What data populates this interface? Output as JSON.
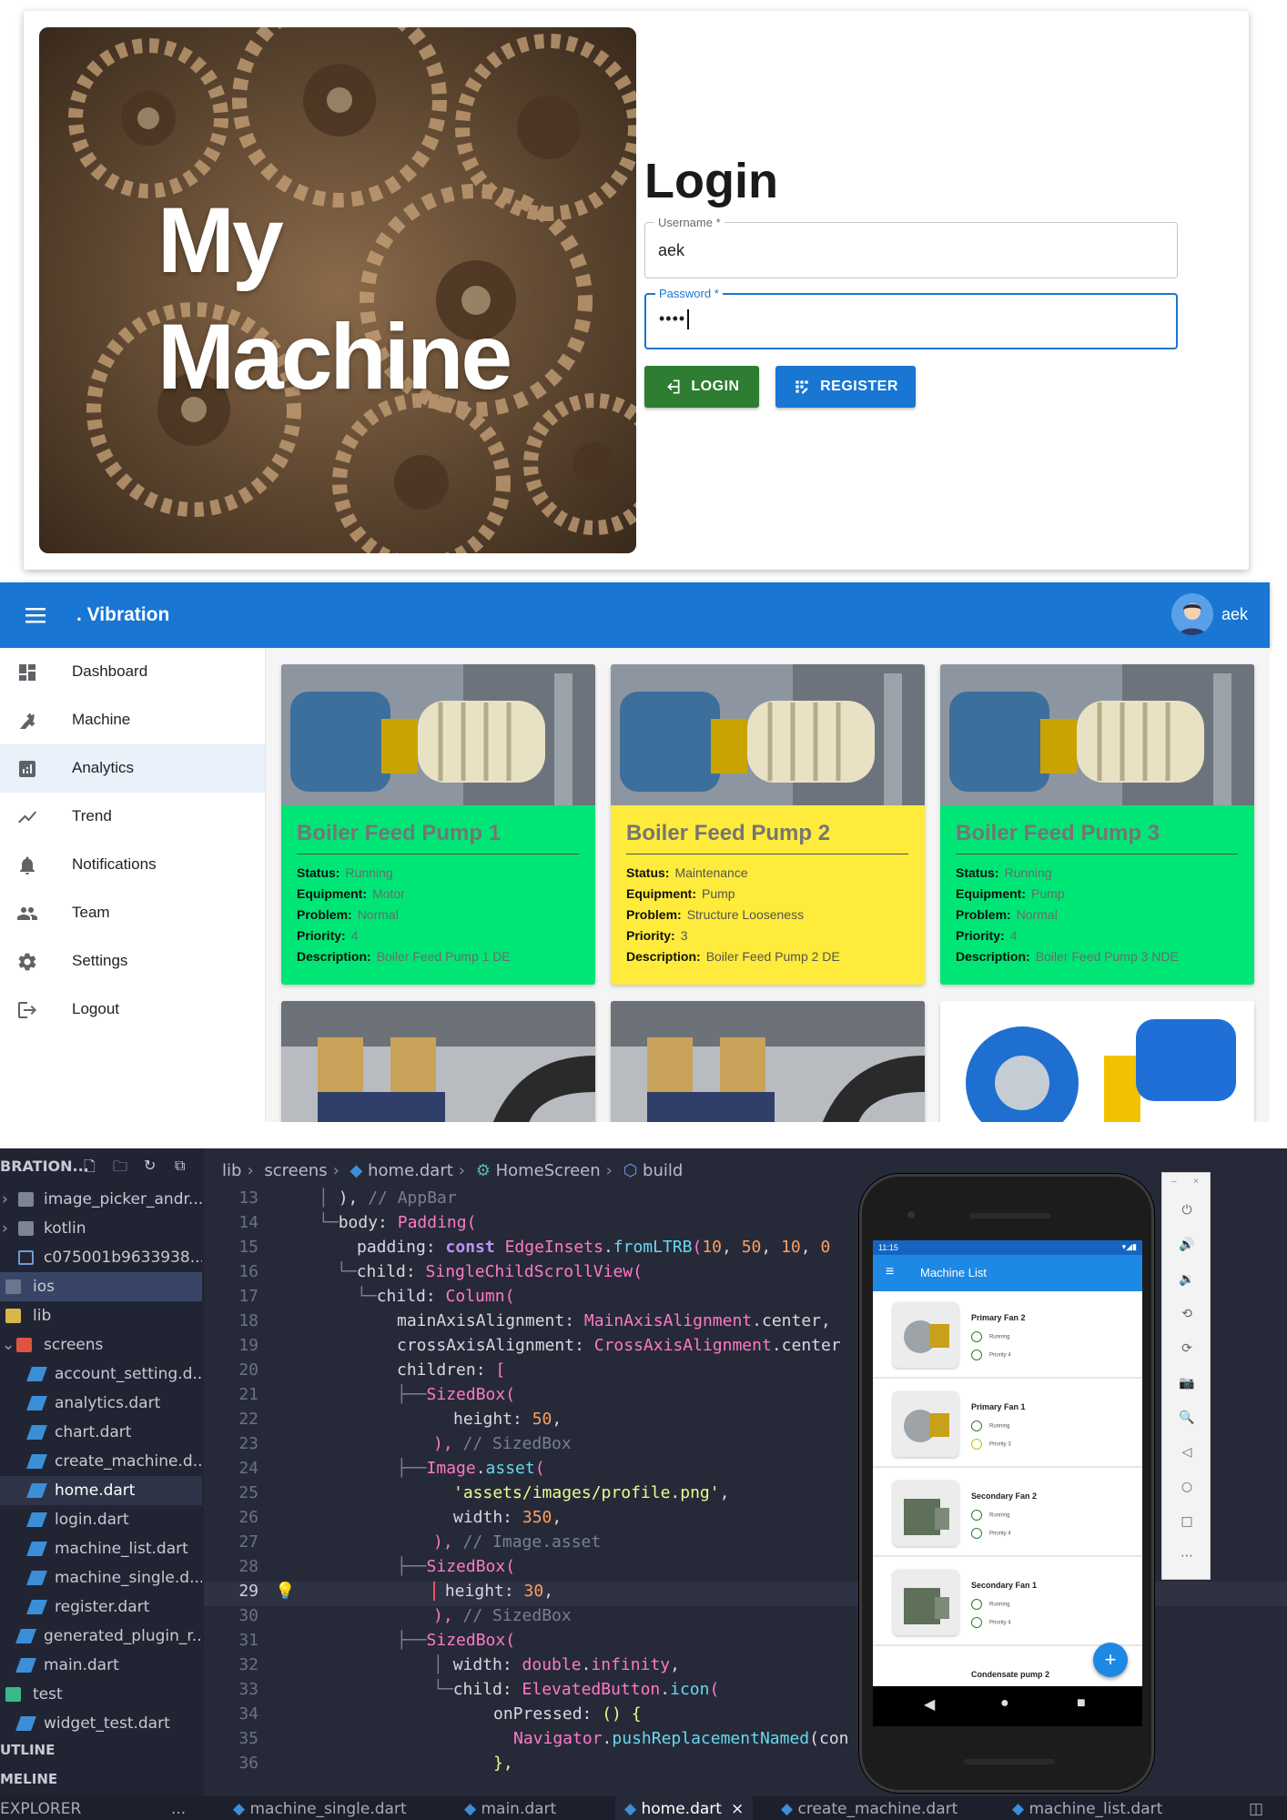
{
  "login": {
    "hero_line1": "My",
    "hero_line2": "Machine",
    "title": "Login",
    "username_label": "Username *",
    "username_value": "aek",
    "password_label": "Password *",
    "password_value": "••••",
    "login_button": "LOGIN",
    "register_button": "REGISTER",
    "accent_green": "#2e7d32",
    "accent_blue": "#1976d2"
  },
  "dashboard": {
    "app_title": ". Vibration",
    "user_name": "aek",
    "nav": [
      {
        "label": "Dashboard",
        "icon": "dashboard-icon"
      },
      {
        "label": "Machine",
        "icon": "precision-icon"
      },
      {
        "label": "Analytics",
        "icon": "analytics-icon",
        "active": true
      },
      {
        "label": "Trend",
        "icon": "trend-icon"
      },
      {
        "label": "Notifications",
        "icon": "bell-icon"
      },
      {
        "label": "Team",
        "icon": "team-icon"
      },
      {
        "label": "Settings",
        "icon": "gear-icon"
      },
      {
        "label": "Logout",
        "icon": "logout-icon"
      }
    ],
    "cards": [
      {
        "title": "Boiler Feed Pump 1",
        "status": "Running",
        "equipment": "Motor",
        "problem": "Normal",
        "priority": "4",
        "description": "Boiler Feed Pump 1 DE",
        "color": "#00e676"
      },
      {
        "title": "Boiler Feed Pump 2",
        "status": "Maintenance",
        "equipment": "Pump",
        "problem": "Structure Looseness",
        "priority": "3",
        "description": "Boiler Feed Pump 2 DE",
        "color": "#ffeb3b"
      },
      {
        "title": "Boiler Feed Pump 3",
        "status": "Running",
        "equipment": "Pump",
        "problem": "Normal",
        "priority": "4",
        "description": "Boiler Feed Pump 3 NDE",
        "color": "#00e676"
      }
    ],
    "labels": {
      "status": "Status:",
      "equipment": "Equipment:",
      "problem": "Problem:",
      "priority": "Priority:",
      "description": "Description:"
    }
  },
  "ide": {
    "explorer_title": "BRATION...",
    "tree": [
      {
        "label": "image_picker_andr...",
        "icon": "folder-icon"
      },
      {
        "label": "kotlin",
        "icon": "folder-icon"
      },
      {
        "label": "c075001b9633938...",
        "icon": "file-icon"
      },
      {
        "label": "ios",
        "icon": "ios-folder-icon"
      },
      {
        "label": "lib",
        "icon": "folder-icon"
      },
      {
        "label": "screens",
        "icon": "folder-open-icon"
      },
      {
        "label": "account_setting.d...",
        "icon": "dart-icon"
      },
      {
        "label": "analytics.dart",
        "icon": "dart-icon"
      },
      {
        "label": "chart.dart",
        "icon": "dart-icon"
      },
      {
        "label": "create_machine.d...",
        "icon": "dart-icon"
      },
      {
        "label": "home.dart",
        "icon": "dart-icon"
      },
      {
        "label": "login.dart",
        "icon": "dart-icon"
      },
      {
        "label": "machine_list.dart",
        "icon": "dart-icon"
      },
      {
        "label": "machine_single.d...",
        "icon": "dart-icon"
      },
      {
        "label": "register.dart",
        "icon": "dart-icon"
      },
      {
        "label": "generated_plugin_r...",
        "icon": "dart-icon"
      },
      {
        "label": "main.dart",
        "icon": "dart-icon"
      },
      {
        "label": "test",
        "icon": "test-folder-icon"
      },
      {
        "label": "widget_test.dart",
        "icon": "dart-icon"
      }
    ],
    "outline": "UTLINE",
    "timeline": "MELINE",
    "breadcrumb": [
      "lib",
      "screens",
      "home.dart",
      "HomeScreen",
      "build"
    ],
    "line_numbers": [
      "13",
      "14",
      "15",
      "16",
      "17",
      "18",
      "19",
      "20",
      "21",
      "22",
      "23",
      "24",
      "25",
      "26",
      "27",
      "28",
      "29",
      "30",
      "31",
      "32",
      "33",
      "34",
      "35",
      "36"
    ],
    "code": {
      "l13a": "), ",
      "l13b": "// AppBar",
      "l14a": "body",
      "l14b": ": ",
      "l14c": "Padding",
      "l14d": "(",
      "l15a": "padding: ",
      "l15b": "const ",
      "l15c": "EdgeInsets",
      "l15d": ".",
      "l15e": "fromLTRB",
      "l15f": "(",
      "l15g": "10",
      "l15h": ", ",
      "l15i": "50",
      "l15j": ", ",
      "l15k": "10",
      "l15l": ", ",
      "l15m": "0",
      "l16a": "child: ",
      "l16b": "SingleChildScrollView",
      "l16c": "(",
      "l17a": "child: ",
      "l17b": "Column",
      "l17c": "(",
      "l18a": "mainAxisAlignment: ",
      "l18b": "MainAxisAlignment",
      "l18c": ".center,",
      "l19a": "crossAxisAlignment: ",
      "l19b": "CrossAxisAlignment",
      "l19c": ".center",
      "l20a": "children: ",
      "l20b": "[",
      "l21a": "SizedBox",
      "l21b": "(",
      "l22a": "height: ",
      "l22b": "50",
      "l22c": ",",
      "l23a": "), ",
      "l23b": "// SizedBox",
      "l24a": "Image",
      "l24b": ".",
      "l24c": "asset",
      "l24d": "(",
      "l25a": "'assets/images/profile.png'",
      "l25b": ",",
      "l26a": "width: ",
      "l26b": "350",
      "l26c": ",",
      "l27a": "), ",
      "l27b": "// Image.asset",
      "l28a": "SizedBox",
      "l28b": "(",
      "l29a": "height: ",
      "l29b": "30",
      "l29c": ",",
      "l30a": "), ",
      "l30b": "// SizedBox",
      "l31a": "SizedBox",
      "l31b": "(",
      "l32a": "width: ",
      "l32b": "double",
      "l32c": ".",
      "l32d": "infinity",
      "l32e": ",",
      "l33a": "child: ",
      "l33b": "ElevatedButton",
      "l33c": ".",
      "l33d": "icon",
      "l33e": "(",
      "l34a": "onPressed: ",
      "l34b": "() {",
      "l35a": "Navigator",
      "l35b": ".",
      "l35c": "pushReplacementNamed",
      "l35d": "(con",
      "l36a": "},"
    },
    "tabs": [
      "EXPLORER",
      "...",
      "machine_single.dart",
      "main.dart",
      "home.dart",
      "create_machine.dart",
      "machine_list.dart"
    ],
    "phone": {
      "time": "11:15",
      "title": "Machine List",
      "items": [
        {
          "name": "Primary Fan 2",
          "status": "Running",
          "priority": "Priority 4"
        },
        {
          "name": "Primary Fan 1",
          "status": "Running",
          "priority": "Priority 3"
        },
        {
          "name": "Secondary Fan 2",
          "status": "Running",
          "priority": "Priority 4"
        },
        {
          "name": "Secondary Fan 1",
          "status": "Running",
          "priority": "Priority 4"
        },
        {
          "name": "Condensate pump 2",
          "status": "",
          "priority": ""
        }
      ],
      "fab": "+"
    }
  }
}
